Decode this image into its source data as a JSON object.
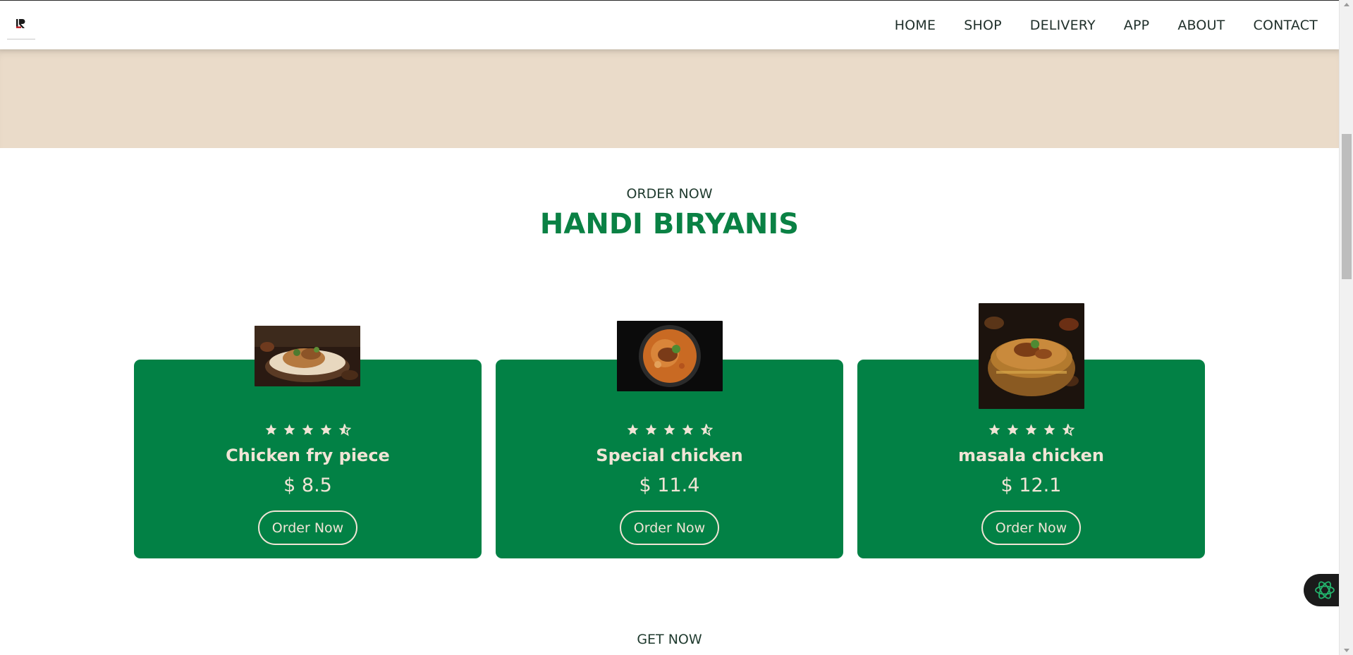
{
  "colors": {
    "brand_green": "#028145",
    "title_green": "#0a8144",
    "beige": "#eadbc9",
    "card_text": "#f0e4d5",
    "nav_text": "#1f2f2a"
  },
  "nav": {
    "logo_icon": "lr-logo-icon",
    "links": [
      "HOME",
      "SHOP",
      "DELIVERY",
      "APP",
      "ABOUT",
      "CONTACT"
    ]
  },
  "order_section": {
    "eyebrow": "ORDER NOW",
    "title": "HANDI BIRYANIS",
    "cards": [
      {
        "name": "Chicken fry piece",
        "price": "$ 8.5",
        "rating": 4.5,
        "button": "Order Now",
        "image_icon": "biryani-plate-image"
      },
      {
        "name": "Special chicken",
        "price": "$ 11.4",
        "rating": 4.5,
        "button": "Order Now",
        "image_icon": "biryani-bowl-image"
      },
      {
        "name": "masala chicken",
        "price": "$ 12.1",
        "rating": 4.5,
        "button": "Order Now",
        "image_icon": "biryani-handi-image"
      }
    ]
  },
  "next_section": {
    "eyebrow": "GET NOW"
  },
  "floating_widget": {
    "icon": "ai-assistant-icon"
  }
}
